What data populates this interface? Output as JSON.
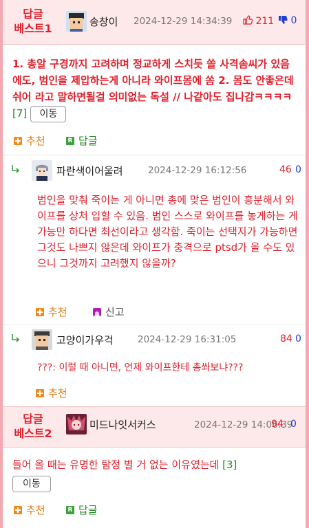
{
  "best1": {
    "label_line1": "답글",
    "label_line2": "베스트1",
    "username": "송창이",
    "date": "2024-12-29 14:34:39",
    "up": "211",
    "down": "0",
    "text": "1. 총알 구경까지 고려하며 정교하게 스치듯 쏠 사격솜씨가 있음에도, 범인을 제압하는게 아니라 와이프몸에 쏨 2. 몸도 안좋은데 쉬어 라고 말하면될걸 의미없는 독설 // 나같아도 집나감ㅋㅋㅋㅋ",
    "reply_count": "[7]",
    "move_label": "이동",
    "recommend_label": "추천",
    "reply_label": "답글"
  },
  "reply1": {
    "username": "파란색이어울려",
    "date": "2024-12-29 16:12:56",
    "up": "46",
    "down": "0",
    "text": "범인을 맞춰 죽이는 게 아니면 총에 맞은 범인이 흥분해서 와이프를 상처 입힐 수 있음. 범인 스스로 와이프를 놓게하는 게 가능만 하다면 최선이라고 생각함. 죽이는 선택지가 가능하면 그것도 나쁘지 않은데 와이프가 충격으로 ptsd가 올 수도 있으니 그것까지 고려했지 않을까?",
    "recommend_label": "추천",
    "report_label": "신고"
  },
  "reply2": {
    "username": "고양이가우걱",
    "date": "2024-12-29 16:31:05",
    "up": "84",
    "down": "0",
    "text": "???: 이럴 때 아니면, 언제 와이프한테 총쏴보냐???",
    "recommend_label": "추천"
  },
  "best2": {
    "label_line1": "답글",
    "label_line2": "베스트2",
    "username": "미드나잇서커스",
    "date": "2024-12-29 14:06:39",
    "up": "94",
    "down": "0",
    "text": "들어 올 때는 유명한 탐정 별 거 없는 이유였는데",
    "reply_count": "[3]",
    "move_label": "이동",
    "recommend_label": "추천",
    "reply_label": "답글"
  }
}
